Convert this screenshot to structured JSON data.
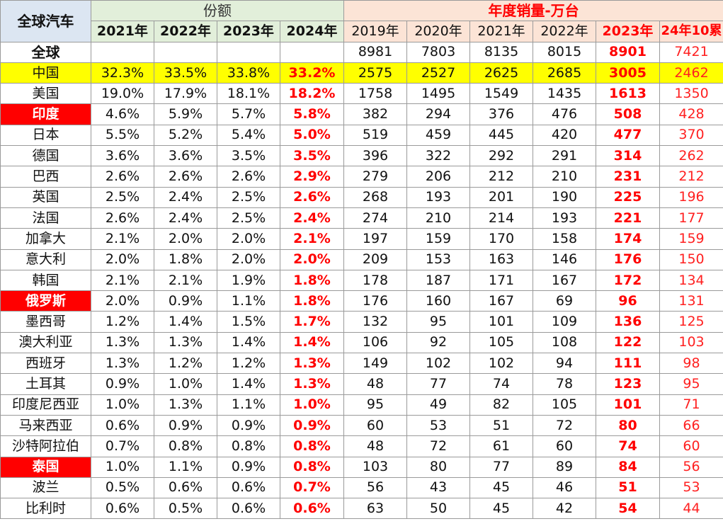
{
  "header": {
    "corner_title": "全球汽车",
    "share_title": "份额",
    "sales_title": "年度销量-万台",
    "share_years": [
      "2021年",
      "2022年",
      "2023年",
      "2024年"
    ],
    "sales_years": [
      "2019年",
      "2020年",
      "2021年",
      "2022年",
      "2023年",
      "24年10累"
    ]
  },
  "rows": [
    {
      "country": "全球",
      "share": [
        "",
        "",
        "",
        ""
      ],
      "sales": [
        "8981",
        "7803",
        "8135",
        "8015",
        "8901",
        "7421"
      ]
    },
    {
      "country": "中国",
      "share": [
        "32.3%",
        "33.5%",
        "33.8%",
        "33.2%"
      ],
      "sales": [
        "2575",
        "2527",
        "2625",
        "2685",
        "3005",
        "2462"
      ]
    },
    {
      "country": "美国",
      "share": [
        "19.0%",
        "17.9%",
        "18.1%",
        "18.2%"
      ],
      "sales": [
        "1758",
        "1495",
        "1549",
        "1435",
        "1613",
        "1350"
      ]
    },
    {
      "country": "印度",
      "share": [
        "4.6%",
        "5.9%",
        "5.7%",
        "5.8%"
      ],
      "sales": [
        "382",
        "294",
        "376",
        "476",
        "508",
        "428"
      ]
    },
    {
      "country": "日本",
      "share": [
        "5.5%",
        "5.2%",
        "5.4%",
        "5.0%"
      ],
      "sales": [
        "519",
        "459",
        "445",
        "420",
        "477",
        "370"
      ]
    },
    {
      "country": "德国",
      "share": [
        "3.6%",
        "3.6%",
        "3.5%",
        "3.5%"
      ],
      "sales": [
        "396",
        "322",
        "292",
        "291",
        "314",
        "262"
      ]
    },
    {
      "country": "巴西",
      "share": [
        "2.6%",
        "2.6%",
        "2.6%",
        "2.9%"
      ],
      "sales": [
        "279",
        "206",
        "212",
        "210",
        "231",
        "212"
      ]
    },
    {
      "country": "英国",
      "share": [
        "2.5%",
        "2.4%",
        "2.5%",
        "2.6%"
      ],
      "sales": [
        "268",
        "193",
        "201",
        "190",
        "225",
        "196"
      ]
    },
    {
      "country": "法国",
      "share": [
        "2.6%",
        "2.4%",
        "2.5%",
        "2.4%"
      ],
      "sales": [
        "274",
        "210",
        "214",
        "193",
        "221",
        "177"
      ]
    },
    {
      "country": "加拿大",
      "share": [
        "2.1%",
        "2.0%",
        "2.0%",
        "2.1%"
      ],
      "sales": [
        "197",
        "159",
        "170",
        "158",
        "174",
        "159"
      ]
    },
    {
      "country": "意大利",
      "share": [
        "2.0%",
        "1.8%",
        "2.0%",
        "2.0%"
      ],
      "sales": [
        "209",
        "153",
        "163",
        "146",
        "176",
        "150"
      ]
    },
    {
      "country": "韩国",
      "share": [
        "2.1%",
        "2.1%",
        "1.9%",
        "1.8%"
      ],
      "sales": [
        "178",
        "187",
        "171",
        "167",
        "172",
        "134"
      ]
    },
    {
      "country": "俄罗斯",
      "share": [
        "2.0%",
        "0.9%",
        "1.1%",
        "1.8%"
      ],
      "sales": [
        "176",
        "160",
        "167",
        "69",
        "96",
        "131"
      ]
    },
    {
      "country": "墨西哥",
      "share": [
        "1.2%",
        "1.4%",
        "1.5%",
        "1.7%"
      ],
      "sales": [
        "132",
        "95",
        "101",
        "109",
        "136",
        "125"
      ]
    },
    {
      "country": "澳大利亚",
      "share": [
        "1.3%",
        "1.3%",
        "1.4%",
        "1.4%"
      ],
      "sales": [
        "106",
        "92",
        "105",
        "108",
        "122",
        "103"
      ]
    },
    {
      "country": "西班牙",
      "share": [
        "1.3%",
        "1.2%",
        "1.2%",
        "1.3%"
      ],
      "sales": [
        "149",
        "102",
        "102",
        "94",
        "111",
        "98"
      ]
    },
    {
      "country": "土耳其",
      "share": [
        "0.9%",
        "1.0%",
        "1.4%",
        "1.3%"
      ],
      "sales": [
        "48",
        "77",
        "74",
        "78",
        "123",
        "95"
      ]
    },
    {
      "country": "印度尼西亚",
      "share": [
        "1.0%",
        "1.3%",
        "1.1%",
        "1.0%"
      ],
      "sales": [
        "95",
        "49",
        "82",
        "105",
        "101",
        "71"
      ]
    },
    {
      "country": "马来西亚",
      "share": [
        "0.6%",
        "0.9%",
        "0.9%",
        "0.9%"
      ],
      "sales": [
        "60",
        "53",
        "51",
        "72",
        "80",
        "66"
      ]
    },
    {
      "country": "沙特阿拉伯",
      "share": [
        "0.7%",
        "0.8%",
        "0.8%",
        "0.8%"
      ],
      "sales": [
        "48",
        "72",
        "61",
        "60",
        "74",
        "60"
      ]
    },
    {
      "country": "泰国",
      "share": [
        "1.0%",
        "1.1%",
        "0.9%",
        "0.8%"
      ],
      "sales": [
        "103",
        "80",
        "77",
        "89",
        "84",
        "56"
      ]
    },
    {
      "country": "波兰",
      "share": [
        "0.5%",
        "0.6%",
        "0.6%",
        "0.7%"
      ],
      "sales": [
        "56",
        "43",
        "45",
        "46",
        "51",
        "53"
      ]
    },
    {
      "country": "比利时",
      "share": [
        "0.6%",
        "0.5%",
        "0.6%",
        "0.6%"
      ],
      "sales": [
        "63",
        "50",
        "45",
        "42",
        "54",
        "44"
      ]
    }
  ],
  "colors": {
    "china_row_bg": "#ffff00",
    "highlight_country_bg": "#ff0000",
    "highlight_text": "#ff0000",
    "share_header_bg": "#e2efda",
    "sales_header_bg": "#fce4d6",
    "corner_header_bg": "#dce6f2"
  }
}
